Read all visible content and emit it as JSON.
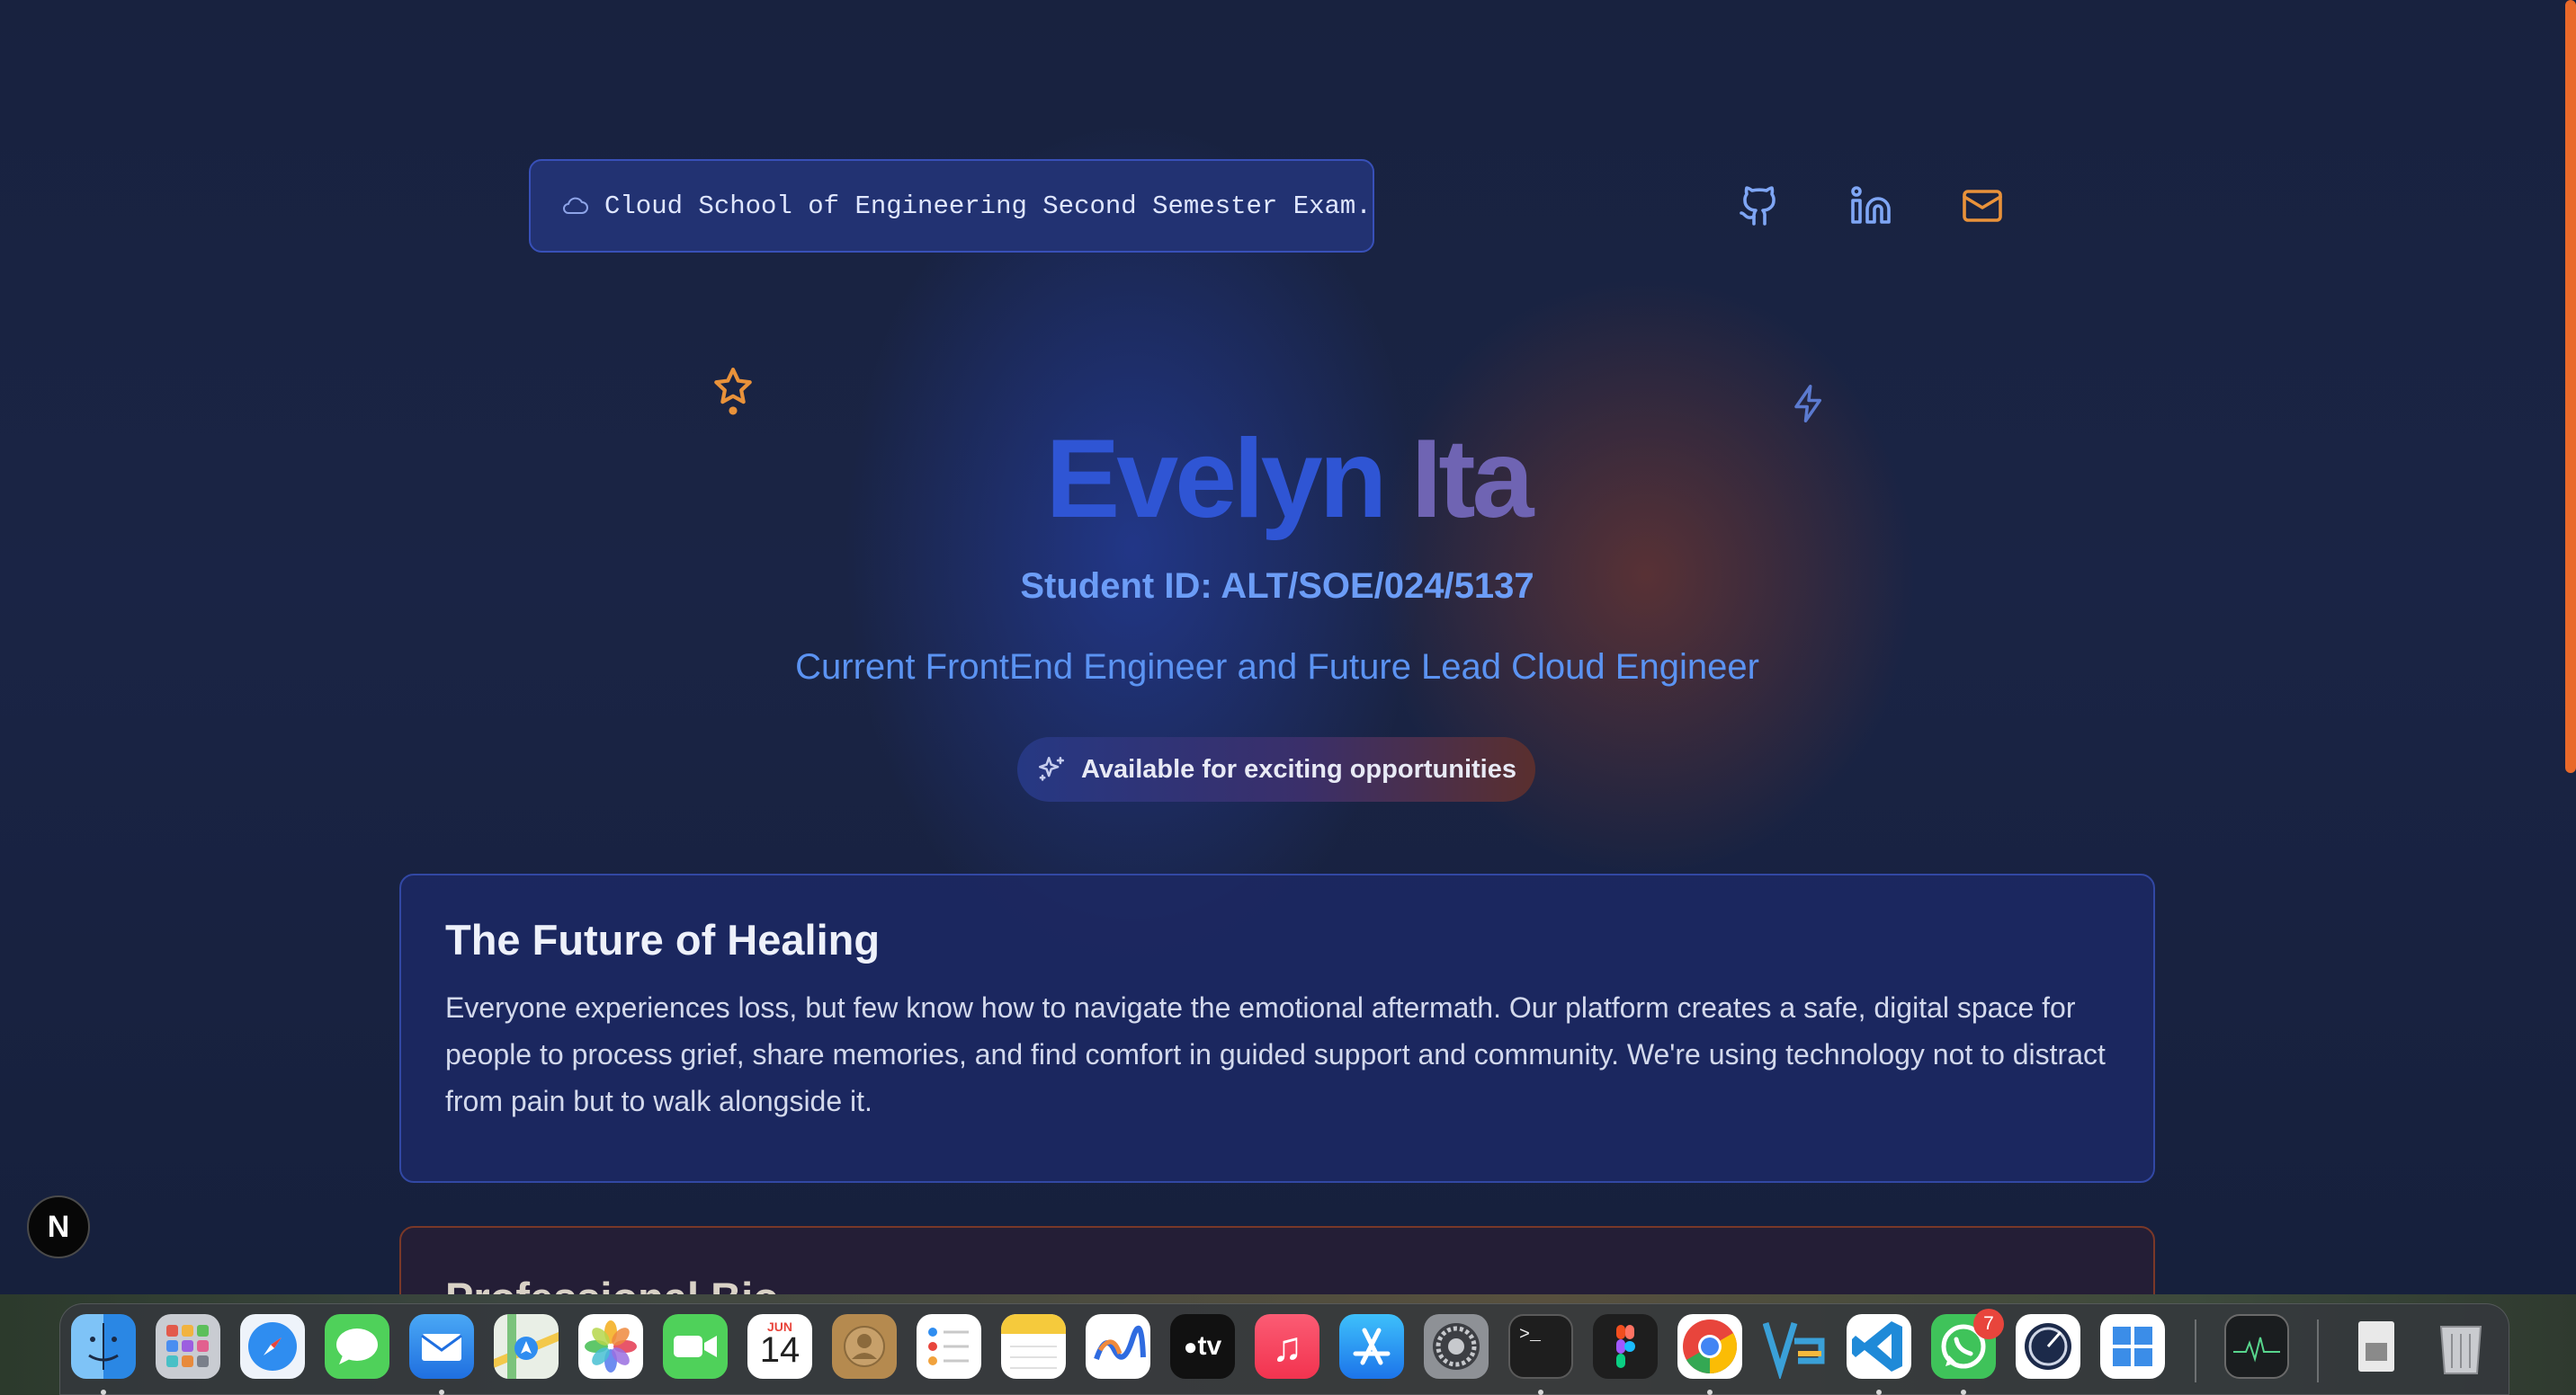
{
  "header": {
    "badge_text": "Cloud School of Engineering Second Semester Exam.",
    "badge_icon": "cloud-icon",
    "social_icons": [
      "github-icon",
      "linkedin-icon",
      "mail-icon"
    ]
  },
  "hero": {
    "first_name": "Evelyn",
    "last_name": "Ita",
    "student_id": "Student ID: ALT/SOE/024/5137",
    "tagline": "Current FrontEnd Engineer and Future Lead Cloud Engineer",
    "availability": "Available for exciting opportunities"
  },
  "cards": [
    {
      "title": "The Future of Healing",
      "body": "Everyone experiences loss, but few know how to navigate the emotional aftermath. Our platform creates a safe, digital space for people to process grief, share memories, and find comfort in guided support and community. We're using technology not to distract from pain but to walk alongside it."
    },
    {
      "title": "Professional Bio"
    }
  ],
  "dev_badge": "N",
  "dock": {
    "calendar_month": "JUN",
    "calendar_day": "14",
    "tv_label": "tv",
    "whatsapp_badge": "7",
    "apps": [
      "finder-icon",
      "launchpad-icon",
      "safari-icon",
      "messages-icon",
      "mail-icon",
      "maps-icon",
      "photos-icon",
      "facetime-icon",
      "calendar-icon",
      "contacts-icon",
      "reminders-icon",
      "notes-icon",
      "freeform-icon",
      "apple-tv-icon",
      "music-icon",
      "app-store-icon",
      "system-settings-icon",
      "terminal-icon",
      "figma-icon",
      "chrome-icon",
      "tableau-icon",
      "vscode-icon",
      "whatsapp-icon",
      "disk-utility-icon",
      "windows-app-icon",
      "activity-monitor-icon",
      "downloads-icon",
      "trash-icon"
    ]
  },
  "colors": {
    "accent_blue": "#2f55d4",
    "accent_orange": "#e9692a",
    "name_purple": "#6f64b3",
    "link_blue": "#6c9df7"
  }
}
